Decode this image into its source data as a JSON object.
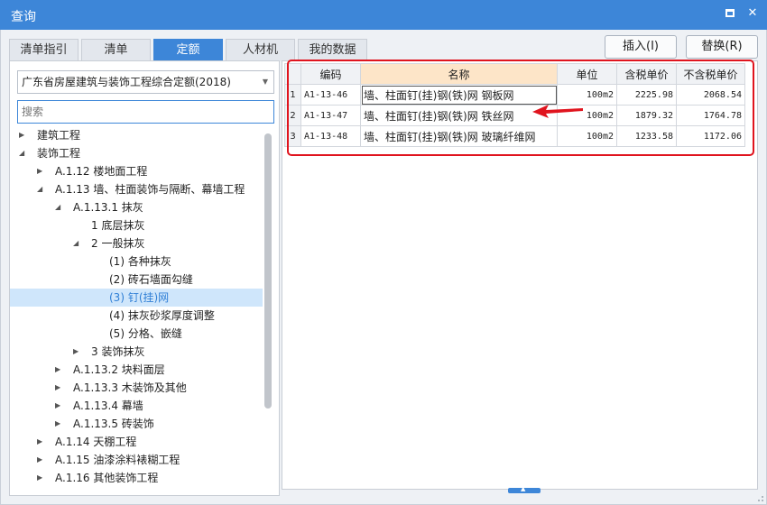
{
  "window": {
    "title": "查询"
  },
  "tabs": [
    {
      "label": "清单指引",
      "active": false
    },
    {
      "label": "清单",
      "active": false
    },
    {
      "label": "定额",
      "active": true
    },
    {
      "label": "人材机",
      "active": false
    },
    {
      "label": "我的数据",
      "active": false
    }
  ],
  "actions": {
    "insert": "插入(I)",
    "replace": "替换(R)"
  },
  "library": {
    "selected": "广东省房屋建筑与装饰工程综合定额(2018)"
  },
  "search": {
    "placeholder": "搜索"
  },
  "tree": [
    {
      "label": "建筑工程",
      "level": 0,
      "expanded": false,
      "has_children": true
    },
    {
      "label": "装饰工程",
      "level": 0,
      "expanded": true,
      "has_children": true
    },
    {
      "label": "A.1.12 楼地面工程",
      "level": 1,
      "expanded": false,
      "has_children": true
    },
    {
      "label": "A.1.13 墙、柱面装饰与隔断、幕墙工程",
      "level": 1,
      "expanded": true,
      "has_children": true
    },
    {
      "label": "A.1.13.1 抹灰",
      "level": 2,
      "expanded": true,
      "has_children": true
    },
    {
      "label": "1 底层抹灰",
      "level": 3,
      "expanded": false,
      "has_children": false
    },
    {
      "label": "2 一般抹灰",
      "level": 3,
      "expanded": true,
      "has_children": true
    },
    {
      "label": "(1) 各种抹灰",
      "level": 4,
      "expanded": false,
      "has_children": false
    },
    {
      "label": "(2) 砖石墙面勾缝",
      "level": 4,
      "expanded": false,
      "has_children": false
    },
    {
      "label": "(3) 钉(挂)网",
      "level": 4,
      "expanded": false,
      "has_children": false,
      "selected": true
    },
    {
      "label": "(4) 抹灰砂浆厚度调整",
      "level": 4,
      "expanded": false,
      "has_children": false
    },
    {
      "label": "(5) 分格、嵌缝",
      "level": 4,
      "expanded": false,
      "has_children": false
    },
    {
      "label": "3 装饰抹灰",
      "level": 3,
      "expanded": false,
      "has_children": true
    },
    {
      "label": "A.1.13.2 块料面层",
      "level": 2,
      "expanded": false,
      "has_children": true
    },
    {
      "label": "A.1.13.3 木装饰及其他",
      "level": 2,
      "expanded": false,
      "has_children": true
    },
    {
      "label": "A.1.13.4 幕墙",
      "level": 2,
      "expanded": false,
      "has_children": true
    },
    {
      "label": "A.1.13.5 砖装饰",
      "level": 2,
      "expanded": false,
      "has_children": true
    },
    {
      "label": "A.1.14 天棚工程",
      "level": 1,
      "expanded": false,
      "has_children": true
    },
    {
      "label": "A.1.15 油漆涂料裱糊工程",
      "level": 1,
      "expanded": false,
      "has_children": true
    },
    {
      "label": "A.1.16 其他装饰工程",
      "level": 1,
      "expanded": false,
      "has_children": true
    }
  ],
  "grid": {
    "headers": {
      "code": "编码",
      "name": "名称",
      "unit": "单位",
      "price_tax": "含税单价",
      "price_notax": "不含税单价"
    },
    "rows": [
      {
        "num": "1",
        "code": "A1-13-46",
        "name": "墙、柱面钉(挂)钢(铁)网 钢板网",
        "unit": "100m2",
        "price_tax": "2225.98",
        "price_notax": "2068.54"
      },
      {
        "num": "2",
        "code": "A1-13-47",
        "name": "墙、柱面钉(挂)钢(铁)网 铁丝网",
        "unit": "100m2",
        "price_tax": "1879.32",
        "price_notax": "1764.78"
      },
      {
        "num": "3",
        "code": "A1-13-48",
        "name": "墙、柱面钉(挂)钢(铁)网 玻璃纤维网",
        "unit": "100m2",
        "price_tax": "1233.58",
        "price_notax": "1172.06"
      }
    ]
  },
  "colors": {
    "accent": "#3d86d8",
    "highlight": "#e0141e",
    "selected_row": "#cfe6fb",
    "name_header": "#fde5c8"
  }
}
